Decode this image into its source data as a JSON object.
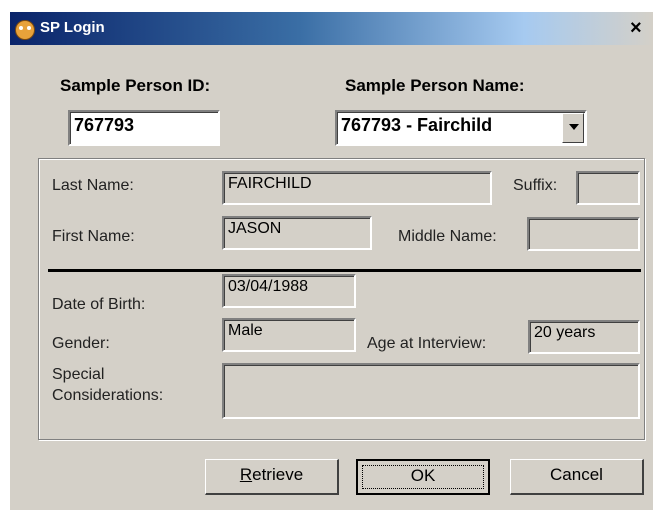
{
  "window": {
    "title": "SP Login",
    "close_glyph": "×"
  },
  "icons": {
    "app": "monkey-app-icon",
    "dropdown": "chevron-down-icon"
  },
  "header": {
    "id_label": "Sample Person ID:",
    "id_value": "767793",
    "name_label": "Sample Person Name:",
    "name_value": "767793 - Fairchild"
  },
  "form": {
    "last_name_label": "Last Name:",
    "last_name_value": "FAIRCHILD",
    "suffix_label": "Suffix:",
    "suffix_value": "",
    "first_name_label": "First Name:",
    "first_name_value": "JASON",
    "middle_name_label": "Middle Name:",
    "middle_name_value": "",
    "dob_label": "Date of Birth:",
    "dob_value": "03/04/1988",
    "gender_label": "Gender:",
    "gender_value": "Male",
    "age_label": "Age at Interview:",
    "age_value": "20 years",
    "special_label_line1": "Special",
    "special_label_line2": "Considerations:",
    "special_value": ""
  },
  "buttons": {
    "retrieve_rest": "etrieve",
    "retrieve_mnemonic": "R",
    "ok": "OK",
    "cancel": "Cancel"
  },
  "colors": {
    "title_start": "#0a246a",
    "title_end": "#a6caf0",
    "face": "#d4d0c8"
  }
}
